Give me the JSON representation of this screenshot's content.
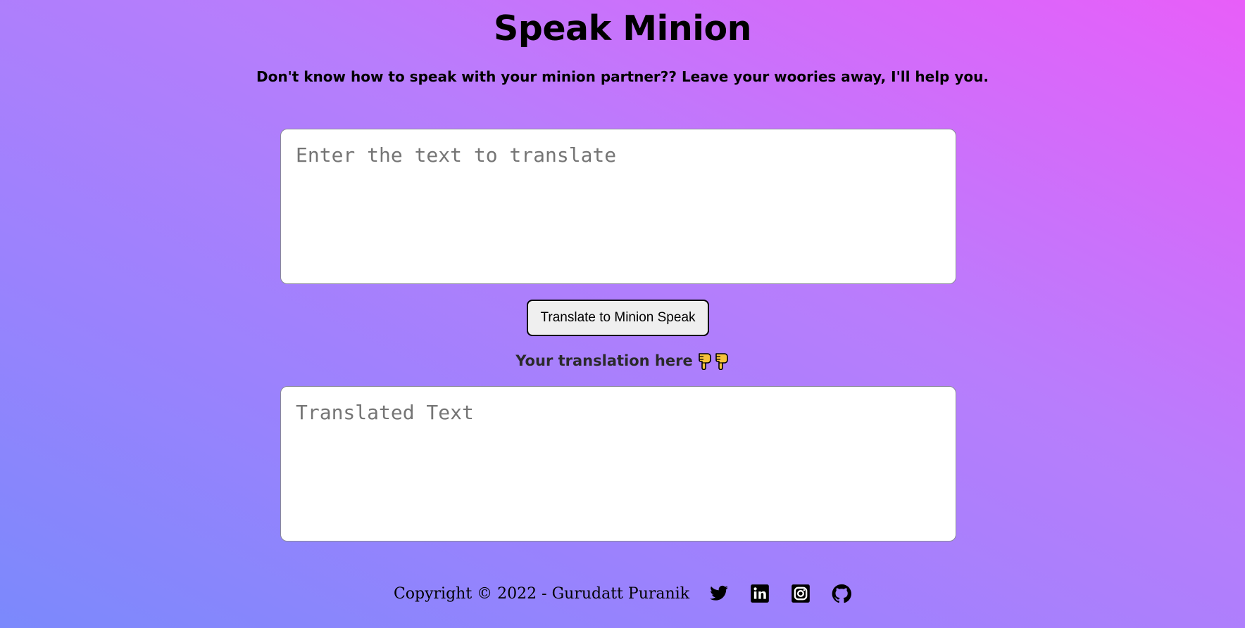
{
  "header": {
    "title": "Speak Minion",
    "subtitle": "Don't know how to speak with your minion partner?? Leave your woories away, I'll help you."
  },
  "input": {
    "placeholder": "Enter the text to translate",
    "value": ""
  },
  "translate_button": {
    "label": "Translate to Minion Speak"
  },
  "output": {
    "label": "Your translation here",
    "label_icons": [
      "pointing-down-icon",
      "pointing-down-icon"
    ],
    "placeholder": "Translated Text",
    "value": ""
  },
  "footer": {
    "copyright": "Copyright © 2022 - Gurudatt Puranik",
    "social": [
      {
        "name": "twitter-icon"
      },
      {
        "name": "linkedin-icon"
      },
      {
        "name": "instagram-icon"
      },
      {
        "name": "github-icon"
      }
    ]
  },
  "colors": {
    "gradient_top_right": "#e85ef9",
    "gradient_bottom_left": "#7b89fc",
    "hand_emoji": "#f7c23b"
  }
}
